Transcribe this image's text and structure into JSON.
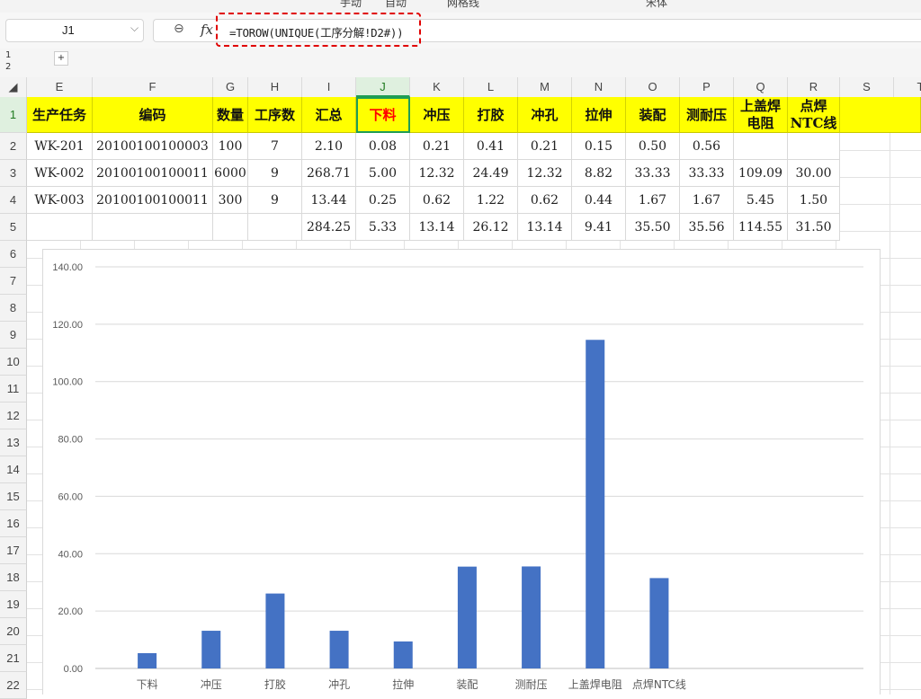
{
  "toolbar": {
    "font_name": "宋体",
    "wrap_label": "网格线",
    "auto_label": "自动",
    "manual_label": "手动"
  },
  "formula_bar": {
    "name_box": "J1",
    "formula": "=TOROW(UNIQUE(工序分解!D2#))"
  },
  "group_levels": [
    "1",
    "2"
  ],
  "columns": [
    "E",
    "F",
    "G",
    "H",
    "I",
    "J",
    "K",
    "L",
    "M",
    "N",
    "O",
    "P",
    "Q",
    "R",
    "S",
    "T"
  ],
  "rows": [
    "1",
    "2",
    "3",
    "4",
    "5",
    "6",
    "7",
    "8",
    "9",
    "10",
    "11",
    "12",
    "13",
    "14",
    "15",
    "16",
    "17",
    "18",
    "19",
    "20",
    "21",
    "22"
  ],
  "sheet": {
    "headers": [
      "生产任务",
      "编码",
      "数量",
      "工序数",
      "汇总",
      "下料",
      "冲压",
      "打胶",
      "冲孔",
      "拉伸",
      "装配",
      "测耐压",
      "上盖焊电阻",
      "点焊NTC线"
    ],
    "header_lines": {
      "上盖焊电阻": [
        "上盖焊",
        "电阻"
      ],
      "点焊NTC线": [
        "点焊",
        "NTC线"
      ]
    },
    "data": [
      [
        "WK-201",
        "20100100100003",
        "100",
        "7",
        "2.10",
        "0.08",
        "0.21",
        "0.41",
        "0.21",
        "0.15",
        "0.50",
        "0.56",
        "",
        ""
      ],
      [
        "WK-002",
        "20100100100011",
        "6000",
        "9",
        "268.71",
        "5.00",
        "12.32",
        "24.49",
        "12.32",
        "8.82",
        "33.33",
        "33.33",
        "109.09",
        "30.00"
      ],
      [
        "WK-003",
        "20100100100011",
        "300",
        "9",
        "13.44",
        "0.25",
        "0.62",
        "1.22",
        "0.62",
        "0.44",
        "1.67",
        "1.67",
        "5.45",
        "1.50"
      ],
      [
        "",
        "",
        "",
        "",
        "284.25",
        "5.33",
        "13.14",
        "26.12",
        "13.14",
        "9.41",
        "35.50",
        "35.56",
        "114.55",
        "31.50"
      ]
    ]
  },
  "chart_data": {
    "type": "bar",
    "categories": [
      "下料",
      "冲压",
      "打胶",
      "冲孔",
      "拉伸",
      "装配",
      "测耐压",
      "上盖焊电阻",
      "点焊NTC线"
    ],
    "values": [
      5.33,
      13.14,
      26.12,
      13.14,
      9.41,
      35.5,
      35.56,
      114.55,
      31.5
    ],
    "title": "",
    "xlabel": "",
    "ylabel": "",
    "ylim": [
      0,
      140
    ],
    "yticks": [
      "0.00",
      "20.00",
      "40.00",
      "60.00",
      "80.00",
      "100.00",
      "120.00",
      "140.00"
    ],
    "grid": true,
    "bar_color": "#4472c4"
  }
}
